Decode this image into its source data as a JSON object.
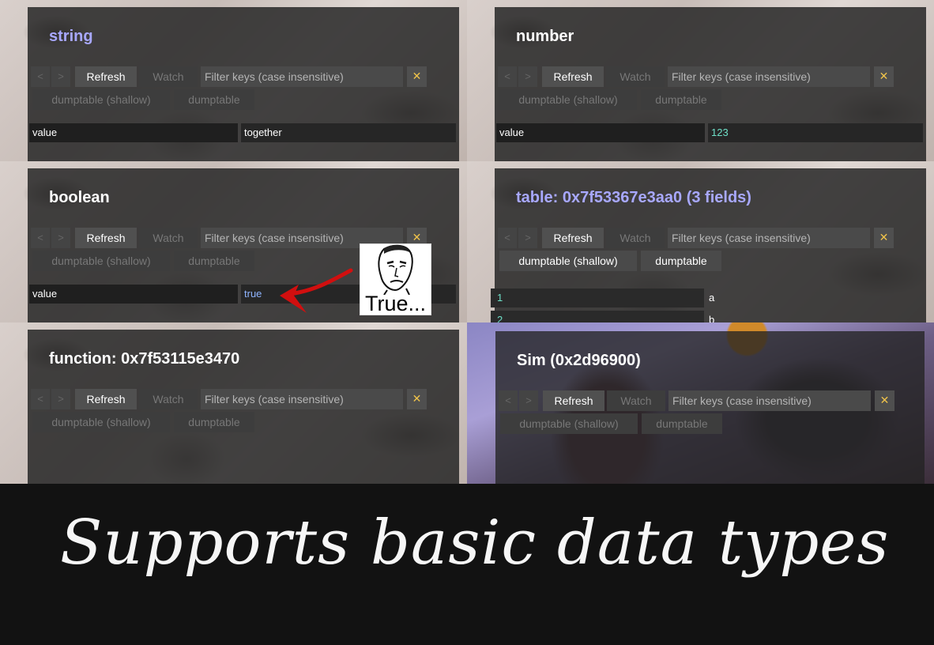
{
  "toolbar": {
    "prev_label": "<",
    "next_label": ">",
    "refresh_label": "Refresh",
    "watch_label": "Watch",
    "filter_placeholder": "Filter keys (case insensitive)",
    "clear_label": "✕",
    "dumptable_shallow_label": "dumptable (shallow)",
    "dumptable_label": "dumptable"
  },
  "panels": [
    {
      "title": "string",
      "rows": [
        {
          "key": "value",
          "value": "together"
        }
      ]
    },
    {
      "title": "number",
      "rows": [
        {
          "key": "value",
          "value": "123"
        }
      ]
    },
    {
      "title": "boolean",
      "rows": [
        {
          "key": "value",
          "value": "true"
        }
      ]
    },
    {
      "title": "table: 0x7f53367e3aa0 (3 fields)",
      "rows": [
        {
          "key": "1",
          "value": "a"
        },
        {
          "key": "2",
          "value": "b"
        }
      ]
    },
    {
      "title": "function: 0x7f53115e3470",
      "rows": []
    },
    {
      "title": "Sim (0x2d96900)",
      "rows": []
    }
  ],
  "meme": {
    "text": "True..."
  },
  "caption": "Supports basic data types",
  "colors": {
    "accent_title": "#a8a8ff",
    "number_value": "#6ee0c8",
    "bool_value": "#8fb4ff",
    "clear_icon": "#f0c34a",
    "arrow": "#d10f0f"
  }
}
